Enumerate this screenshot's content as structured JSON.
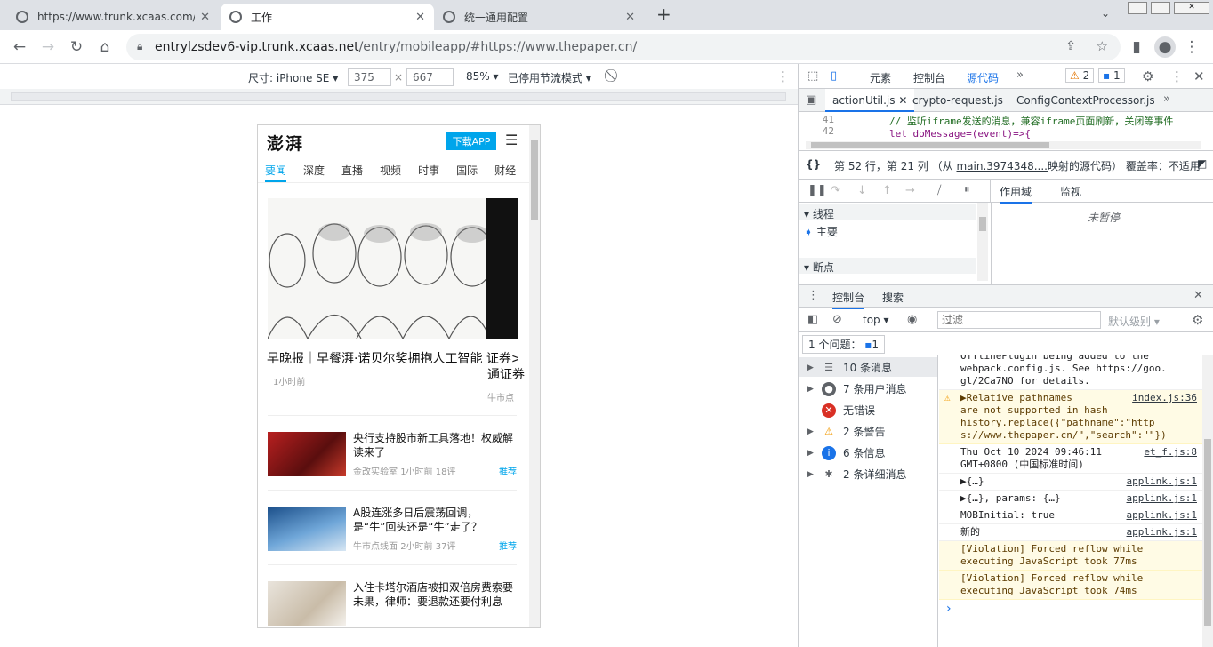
{
  "browser": {
    "tabs": [
      {
        "title": "https://www.trunk.xcaas.com/e"
      },
      {
        "title": "工作"
      },
      {
        "title": "统一通用配置"
      }
    ],
    "new_tab_label": "+",
    "url_host": "entrylzsdev6-vip.trunk.xcaas.net",
    "url_path": "/entry/mobileapp/#https://www.thepaper.cn/"
  },
  "device_toolbar": {
    "dimensions_label": "尺寸: iPhone SE",
    "width": "375",
    "height": "667",
    "times": "×",
    "zoom": "85%",
    "throttle": "已停用节流模式"
  },
  "phone": {
    "logo": "澎湃",
    "download_label": "下载APP",
    "nav": [
      "要闻",
      "深度",
      "直播",
      "视频",
      "时事",
      "国际",
      "财经"
    ],
    "hero": {
      "title": "早晚报｜早餐湃·诺贝尔奖拥抱人工智能",
      "side_title_1": "证券>",
      "side_title_2": "通证券",
      "time": "1小时前",
      "side_source": "牛市点"
    },
    "news": [
      {
        "title": "央行支持股市新工具落地！权威解读来了",
        "source": "金改实验室",
        "time": "1小时前",
        "comments": "18评",
        "tag": "推荐"
      },
      {
        "title": "A股连涨多日后震荡回调，是“牛”回头还是“牛”走了？",
        "source": "牛市点线面",
        "time": "2小时前",
        "comments": "37评",
        "tag": "推荐"
      },
      {
        "title": "入住卡塔尔酒店被扣双倍房费索要未果，律师：要退款还要付利息",
        "source": "",
        "time": "",
        "comments": "",
        "tag": ""
      }
    ]
  },
  "devtools": {
    "panels": [
      "元素",
      "控制台",
      "源代码"
    ],
    "warnings_count": "2",
    "messages_count": "1",
    "files": [
      "actionUtil.js",
      "crypto-request.js",
      "ConfigContextProcessor.js"
    ],
    "code_lines": [
      {
        "num": "41",
        "text": "// 监听iframe发送的消息，兼容iframe页面刷新，关闭等事件"
      },
      {
        "num": "42",
        "text": "let doMessage=(event)=>{"
      }
    ],
    "status": {
      "position": "第 52 行，第 21 列",
      "mapped_prefix": "（从",
      "mapped_link": "main.3974348....",
      "mapped_suffix": "映射的源代码）",
      "coverage": "覆盖率：不适用"
    },
    "scope_tabs": [
      "作用域",
      "监视"
    ],
    "not_paused": "未暂停",
    "threads_label": "线程",
    "main_thread": "主要",
    "breakpoints_label": "断点",
    "drawer_tabs": [
      "控制台",
      "搜索"
    ],
    "context": "top",
    "filter_placeholder": "过滤",
    "levels": "默认级别",
    "issues_label": "1 个问题：",
    "issues_count": "1",
    "sidebar": [
      {
        "label": "10 条消息",
        "icon": "list-icon"
      },
      {
        "label": "7 条用户消息",
        "icon": "user-icon"
      },
      {
        "label": "无错误",
        "icon": "error-icon"
      },
      {
        "label": "2 条警告",
        "icon": "warning-icon"
      },
      {
        "label": "6 条信息",
        "icon": "info-icon"
      },
      {
        "label": "2 条详细消息",
        "icon": "verbose-icon"
      }
    ],
    "console": [
      {
        "type": "log",
        "lines": [
          "OfflinePlugin being added to the",
          "webpack.config.js. See https://goo.",
          "gl/2Ca7NO for details."
        ],
        "src": ""
      },
      {
        "type": "warn",
        "lines": [
          "▶Relative pathnames",
          "are not supported in hash",
          "history.replace({\"pathname\":\"http",
          "s://www.thepaper.cn/\",\"search\":\"\"})"
        ],
        "src": "index.js:36"
      },
      {
        "type": "log",
        "lines": [
          "Thu Oct 10 2024 09:46:11",
          "GMT+0800 (中国标准时间)"
        ],
        "src": "et_f.js:8"
      },
      {
        "type": "log",
        "lines": [
          "▶{…}"
        ],
        "src": "applink.js:1"
      },
      {
        "type": "log",
        "lines": [
          "▶{…}, params: {…}"
        ],
        "src": "applink.js:1"
      },
      {
        "type": "log",
        "lines": [
          "MOBInitial: true"
        ],
        "src": "applink.js:1"
      },
      {
        "type": "log",
        "lines": [
          "新的"
        ],
        "src": "applink.js:1"
      },
      {
        "type": "warn",
        "lines": [
          "[Violation] Forced reflow while",
          "executing JavaScript took 77ms"
        ],
        "src": ""
      },
      {
        "type": "warn",
        "lines": [
          "[Violation] Forced reflow while",
          "executing JavaScript took 74ms"
        ],
        "src": ""
      }
    ],
    "prompt": "›"
  }
}
